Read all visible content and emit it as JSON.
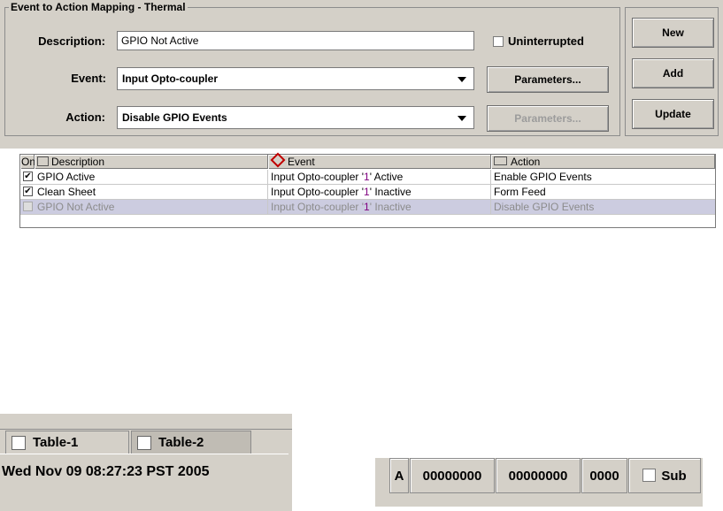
{
  "form": {
    "group_title": "Event to Action Mapping - Thermal",
    "description_label": "Description:",
    "description_value": "GPIO Not Active",
    "uninterrupted_label": "Uninterrupted",
    "event_label": "Event:",
    "event_value": "Input Opto-coupler",
    "action_label": "Action:",
    "action_value": "Disable GPIO Events",
    "event_params_button": "Parameters...",
    "action_params_button": "Parameters..."
  },
  "buttons": {
    "new": "New",
    "add": "Add",
    "update": "Update"
  },
  "table": {
    "headers": {
      "on": "On",
      "description": "Description",
      "event": "Event",
      "action": "Action"
    },
    "rows": [
      {
        "on": true,
        "description": "GPIO Active",
        "event_a": "Input Opto-coupler '",
        "event_num": "1",
        "event_b": "' Active",
        "action": "Enable GPIO Events"
      },
      {
        "on": true,
        "description": "Clean Sheet",
        "event_a": "Input Opto-coupler '",
        "event_num": "1",
        "event_b": "' Inactive",
        "action": "Form Feed"
      },
      {
        "on": false,
        "description": "GPIO Not Active",
        "event_a": "Input Opto-coupler '",
        "event_num": "1",
        "event_b": "' Inactive",
        "action": "Disable GPIO Events"
      }
    ]
  },
  "tabs": {
    "tab1": "Table-1",
    "tab2": "Table-2"
  },
  "status": {
    "datetime": "Wed Nov 09 08:27:23 PST 2005",
    "mode": "A",
    "field1": "00000000",
    "field2": "00000000",
    "field3": "0000",
    "sub_label": "Sub"
  }
}
